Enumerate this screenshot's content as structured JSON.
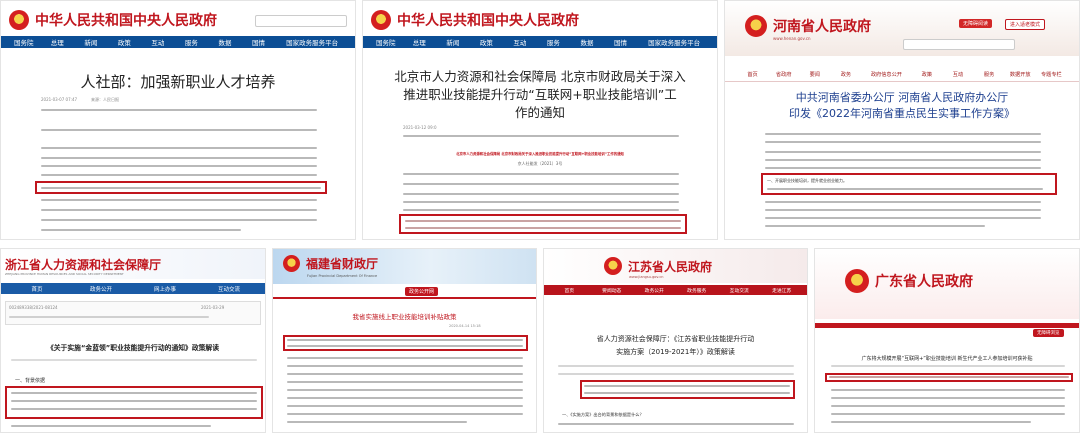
{
  "p1": {
    "site_title": "中华人民共和国中央人民政府",
    "nav": [
      "国务院",
      "总理",
      "新闻",
      "政策",
      "互动",
      "服务",
      "数据",
      "国情",
      "国家政务服务平台"
    ],
    "title": "人社部：加强新职业人才培养",
    "date": "2021-03-07 07:47",
    "source": "来源：人民日报",
    "colors": {
      "bar": "#0c4e95",
      "brand": "#c0161e"
    }
  },
  "p2": {
    "site_title": "中华人民共和国中央人民政府",
    "nav": [
      "国务院",
      "总理",
      "新闻",
      "政策",
      "互动",
      "服务",
      "数据",
      "国情",
      "国家政务服务平台"
    ],
    "title_lines": [
      "北京市人力资源和社会保障局 北京市财政局关于深入",
      "推进职业技能提升行动“互联网+职业技能培训”工",
      "作的通知"
    ],
    "date": "2021-03-12 09:0",
    "red_heading": "北京市人力资源和社会保障局 北京市财政局关于深入推进职业技能提升行动“互联网+职业技能培训”工作的通知",
    "doc_no": "京人社能发〔2021〕3号"
  },
  "p3": {
    "site_title": "河南省人民政府",
    "site_url": "www.henan.gov.cn",
    "btn_primary": "无障碍阅读",
    "btn_secondary": "进入适老模式",
    "nav": [
      "首页",
      "省政府",
      "要闻",
      "政务",
      "政府信息公开",
      "政策",
      "互动",
      "服务",
      "数据开放",
      "专题专栏"
    ],
    "title_lines": [
      "中共河南省委办公厅 河南省人民政府办公厅",
      "印发《2022年河南省重点民生实事工作方案》"
    ],
    "boxed_text": "一、开展职业技能培训，提升就业创业能力。"
  },
  "p4": {
    "site_title": "浙江省人力资源和社会保障厅",
    "site_title_en": "ZHEJIANG PROVINCE HUMAN RESOURCES AND SOCIAL SECURITY DEPARTMENT",
    "nav": [
      "首页",
      "政务公开",
      "网上办事",
      "互动交流"
    ],
    "doc_no": "002489338/2021-08124",
    "date": "2021-03-29",
    "title": "《关于实施“金蓝领”职业技能提升行动的通知》政策解读",
    "section": "一、背景依据"
  },
  "p5": {
    "site_title": "福建省财政厅",
    "site_title_en": "Fujian Provincial Department Of Finance",
    "section_tab": "政务公开网",
    "title": "我省实施线上职业技能培训补贴政策",
    "date": "2020-04-14 15:18"
  },
  "p6": {
    "site_title": "江苏省人民政府",
    "site_url": "www.jiangsu.gov.cn",
    "nav": [
      "首页",
      "要闻动态",
      "政务公开",
      "政务服务",
      "互动交流",
      "走进江苏"
    ],
    "title_lines": [
      "省人力资源社会保障厅：《江苏省职业技能提升行动",
      "实施方案（2019-2021年）》政策解读"
    ],
    "section": "一、《实施方案》出台的背景和依据是什么？"
  },
  "p7": {
    "site_title": "广东省人民政府",
    "button": "无障碍浏览",
    "title": "广东将大规模开展“互联网+”职业技能培训 新生代产业工人参加培训可获补贴"
  }
}
